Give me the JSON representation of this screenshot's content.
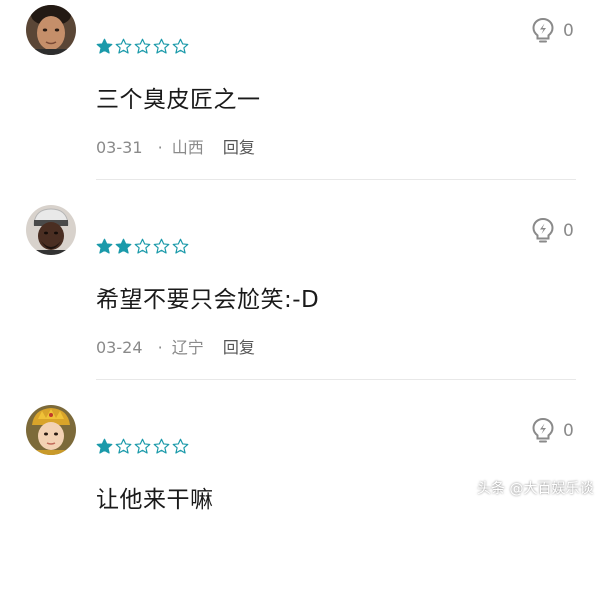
{
  "comments": [
    {
      "avatar_icon": "user-avatar-icon",
      "rating": 1,
      "rating_max": 5,
      "text": "三个臭皮匠之一",
      "date": "03-31",
      "separator": "·",
      "region": "山西",
      "reply_label": "回复",
      "like_icon": "lightbulb-icon",
      "like_count": "0"
    },
    {
      "avatar_icon": "user-avatar-icon",
      "rating": 2,
      "rating_max": 5,
      "text": "希望不要只会尬笑:-D",
      "date": "03-24",
      "separator": "·",
      "region": "辽宁",
      "reply_label": "回复",
      "like_icon": "lightbulb-icon",
      "like_count": "0"
    },
    {
      "avatar_icon": "user-avatar-icon",
      "rating": 1,
      "rating_max": 5,
      "text": "让他来干嘛",
      "date": "",
      "separator": "",
      "region": "",
      "reply_label": "",
      "like_icon": "lightbulb-icon",
      "like_count": "0"
    }
  ],
  "colors": {
    "star": "#1b9aaa",
    "text": "#1a1a1a",
    "meta": "#8a8a8a",
    "divider": "#e8e8e8"
  },
  "watermark": "头条 @大百娱乐谈"
}
